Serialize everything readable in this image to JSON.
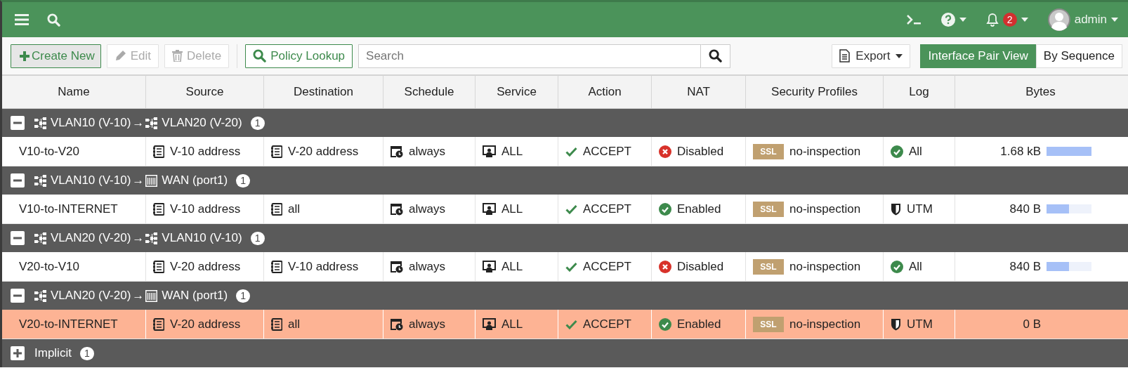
{
  "topbar": {
    "user": "admin",
    "notification_count": "2"
  },
  "toolbar": {
    "buttons": [
      {
        "label": "Create New",
        "kind": "create",
        "disabled": false
      },
      {
        "label": "Edit",
        "kind": "edit",
        "disabled": true
      },
      {
        "label": "Delete",
        "kind": "delete",
        "disabled": true
      },
      {
        "label": "Policy Lookup",
        "kind": "lookup",
        "disabled": false
      }
    ],
    "search": {
      "placeholder": "Search"
    },
    "export": "Export",
    "views": [
      {
        "label": "Interface Pair View",
        "selected": true
      },
      {
        "label": "By Sequence",
        "selected": false
      }
    ]
  },
  "table": {
    "columns": [
      "Name",
      "Source",
      "Destination",
      "Schedule",
      "Service",
      "Action",
      "NAT",
      "Security Profiles",
      "Log",
      "Bytes"
    ],
    "groups": [
      {
        "expanded": true,
        "from": {
          "kind": "vlan",
          "label": "VLAN10 (V-10)"
        },
        "arrow": "→",
        "to": {
          "kind": "vlan",
          "label": "VLAN20 (V-20)"
        },
        "count": "1",
        "rows": [
          {
            "name": "V10-to-V20",
            "source": "V-10 address",
            "destination": "V-20 address",
            "schedule": "always",
            "service": "ALL",
            "action": "ACCEPT",
            "nat": {
              "enabled": false,
              "label": "Disabled"
            },
            "profile_tag": "SSL",
            "profile": "no-inspection",
            "log": {
              "kind": "all",
              "label": "All"
            },
            "bytes": "1.68 kB",
            "level": 1.0,
            "selected": false
          }
        ]
      },
      {
        "expanded": true,
        "from": {
          "kind": "vlan",
          "label": "VLAN10 (V-10)"
        },
        "arrow": "→",
        "to": {
          "kind": "wan",
          "label": "WAN (port1)"
        },
        "count": "1",
        "rows": [
          {
            "name": "V10-to-INTERNET",
            "source": "V-10 address",
            "destination": "all",
            "schedule": "always",
            "service": "ALL",
            "action": "ACCEPT",
            "nat": {
              "enabled": true,
              "label": "Enabled"
            },
            "profile_tag": "SSL",
            "profile": "no-inspection",
            "log": {
              "kind": "utm",
              "label": "UTM"
            },
            "bytes": "840 B",
            "level": 0.5,
            "selected": false
          }
        ]
      },
      {
        "expanded": true,
        "from": {
          "kind": "vlan",
          "label": "VLAN20 (V-20)"
        },
        "arrow": "→",
        "to": {
          "kind": "vlan",
          "label": "VLAN10 (V-10)"
        },
        "count": "1",
        "rows": [
          {
            "name": "V20-to-V10",
            "source": "V-20 address",
            "destination": "V-10 address",
            "schedule": "always",
            "service": "ALL",
            "action": "ACCEPT",
            "nat": {
              "enabled": false,
              "label": "Disabled"
            },
            "profile_tag": "SSL",
            "profile": "no-inspection",
            "log": {
              "kind": "all",
              "label": "All"
            },
            "bytes": "840 B",
            "level": 0.5,
            "selected": false
          }
        ]
      },
      {
        "expanded": true,
        "from": {
          "kind": "vlan",
          "label": "VLAN20 (V-20)"
        },
        "arrow": "→",
        "to": {
          "kind": "wan",
          "label": "WAN (port1)"
        },
        "count": "1",
        "rows": [
          {
            "name": "V20-to-INTERNET",
            "source": "V-20 address",
            "destination": "all",
            "schedule": "always",
            "service": "ALL",
            "action": "ACCEPT",
            "nat": {
              "enabled": true,
              "label": "Enabled"
            },
            "profile_tag": "SSL",
            "profile": "no-inspection",
            "log": {
              "kind": "utm",
              "label": "UTM"
            },
            "bytes": "0 B",
            "selected": true
          }
        ]
      },
      {
        "expanded": false,
        "label": "Implicit",
        "count": "1"
      }
    ]
  }
}
